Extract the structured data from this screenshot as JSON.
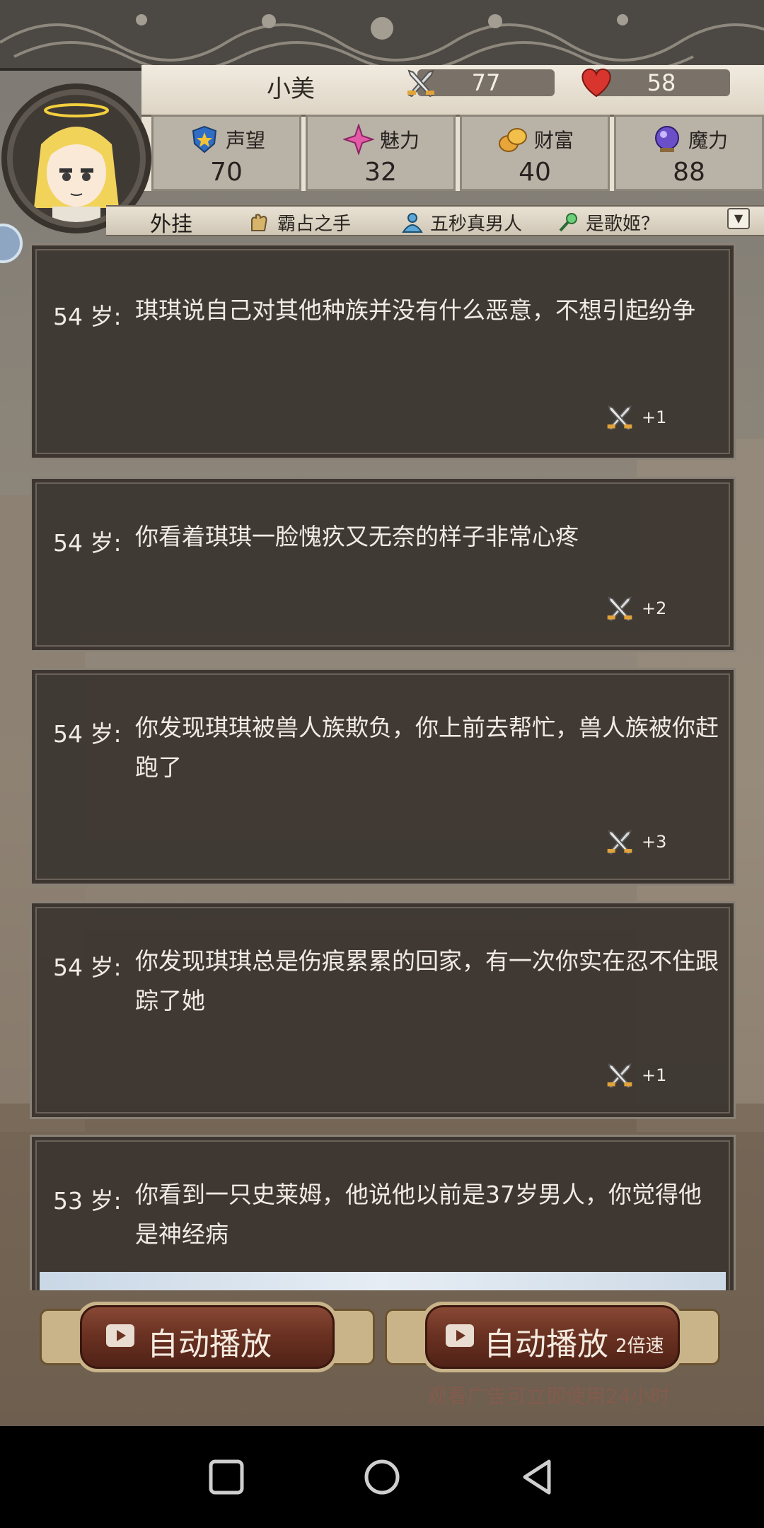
{
  "player": {
    "name": "小美",
    "attack": "77",
    "health": "58"
  },
  "stats": [
    {
      "label": "声望",
      "value": "70",
      "icon": "shield-star-icon"
    },
    {
      "label": "魅力",
      "value": "32",
      "icon": "sparkle-icon"
    },
    {
      "label": "财富",
      "value": "40",
      "icon": "coins-icon"
    },
    {
      "label": "魔力",
      "value": "88",
      "icon": "magic-orb-icon"
    }
  ],
  "skills": {
    "title": "外挂",
    "items": [
      {
        "label": "霸占之手",
        "icon": "hand-icon"
      },
      {
        "label": "五秒真男人",
        "icon": "figure-icon"
      },
      {
        "label": "是歌姬？",
        "icon": "microphone-icon"
      }
    ]
  },
  "events": [
    {
      "age": "54 岁:",
      "text": "琪琪说自己对其他种族并没有什么恶意，不想引起纷争",
      "reward": "+1"
    },
    {
      "age": "54 岁:",
      "text": "你看着琪琪一脸愧疚又无奈的样子非常心疼",
      "reward": "+2"
    },
    {
      "age": "54 岁:",
      "text": "你发现琪琪被兽人族欺负，你上前去帮忙，兽人族被你赶跑了",
      "reward": "+3"
    },
    {
      "age": "54 岁:",
      "text": "你发现琪琪总是伤痕累累的回家，有一次你实在忍不住跟踪了她",
      "reward": "+1"
    },
    {
      "age": "53 岁:",
      "text": "你看到一只史莱姆，他说他以前是37岁男人，你觉得他是神经病",
      "reward": ""
    }
  ],
  "buttons": {
    "autoplay_label": "自动播放",
    "autoplay2x_label": "自动播放",
    "autoplay2x_sub": "2倍速",
    "ad_hint": "观看广告可立即使用24小时"
  },
  "colors": {
    "card_bg": "#3c3530",
    "button_red": "#6b3222",
    "button_gold": "#c9b48a",
    "header_cream": "#e8e0d2"
  }
}
